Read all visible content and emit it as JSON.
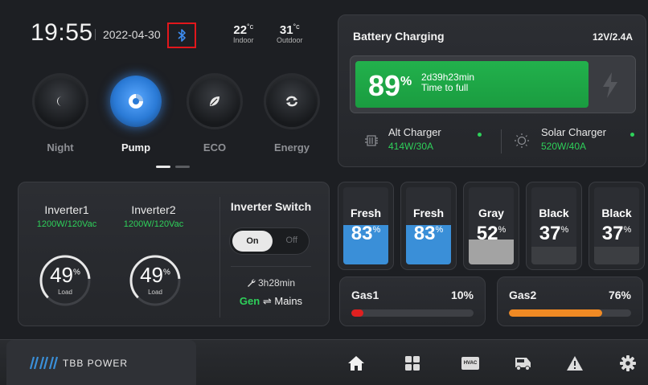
{
  "status": {
    "time": "19:55",
    "date": "2022-04-30",
    "indoor": {
      "value": "22",
      "unit": "°c",
      "label": "Indoor"
    },
    "outdoor": {
      "value": "31",
      "unit": "°c",
      "label": "Outdoor"
    }
  },
  "modes": [
    {
      "label": "Night",
      "icon": "moon-icon",
      "active": false
    },
    {
      "label": "Pump",
      "icon": "pump-icon",
      "active": true
    },
    {
      "label": "ECO",
      "icon": "leaf-icon",
      "active": false
    },
    {
      "label": "Energy",
      "icon": "refresh-icon",
      "active": false
    }
  ],
  "page_indicator": {
    "pages": 2,
    "current": 1
  },
  "battery": {
    "title": "Battery Charging",
    "spec": "12V/2.4A",
    "percent": "89",
    "percent_unit": "%",
    "level": 89,
    "time": "2d39h23min",
    "time_label": "Time to full",
    "alt_charger": {
      "name": "Alt Charger",
      "value": "414W/30A"
    },
    "solar_charger": {
      "name": "Solar Charger",
      "value": "520W/40A"
    }
  },
  "inverters": [
    {
      "name": "Inverter1",
      "spec": "1200W/120Vac",
      "load": "49",
      "load_unit": "%",
      "load_label": "Load",
      "level": 49
    },
    {
      "name": "Inverter2",
      "spec": "1200W/120Vac",
      "load": "49",
      "load_unit": "%",
      "load_label": "Load",
      "level": 49
    }
  ],
  "inverter_switch": {
    "title": "Inverter Switch",
    "on_label": "On",
    "off_label": "Off",
    "runtime": "3h28min",
    "gen": "Gen",
    "arrow": "⇌",
    "mains": "Mains"
  },
  "tanks": [
    {
      "name": "Fresh",
      "value": "83",
      "unit": "%",
      "level": 83,
      "color": "#3a8fd8"
    },
    {
      "name": "Fresh",
      "value": "83",
      "unit": "%",
      "level": 83,
      "color": "#3a8fd8"
    },
    {
      "name": "Gray",
      "value": "52",
      "unit": "%",
      "level": 52,
      "color": "#a3a3a3"
    },
    {
      "name": "Black",
      "value": "37",
      "unit": "%",
      "level": 37,
      "color": "#3c3e42"
    },
    {
      "name": "Black",
      "value": "37",
      "unit": "%",
      "level": 37,
      "color": "#3c3e42"
    }
  ],
  "gas": [
    {
      "name": "Gas1",
      "percent": "10%",
      "level": 10,
      "color": "#e02020"
    },
    {
      "name": "Gas2",
      "percent": "76%",
      "level": 76,
      "color": "#f08a24"
    }
  ],
  "brand": {
    "text": "TBB POWER"
  },
  "nav": {
    "items": [
      "home-icon",
      "grid-icon",
      "hvac-icon",
      "rv-icon",
      "warning-icon",
      "settings-icon"
    ],
    "hvac_label": "HVAC"
  },
  "colors": {
    "accent_blue": "#3a8fd8",
    "green": "#2ed15a",
    "battery_green": "#1fa845",
    "alert_red": "#e2171c"
  }
}
